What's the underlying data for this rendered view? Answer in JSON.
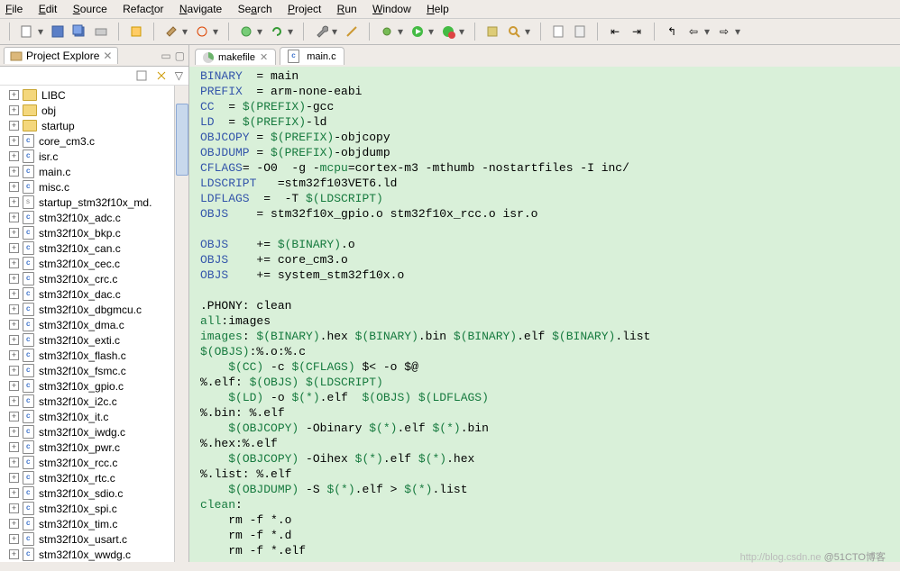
{
  "menubar": {
    "file": "File",
    "edit": "Edit",
    "source": "Source",
    "refactor": "Refactor",
    "navigate": "Navigate",
    "search": "Search",
    "project": "Project",
    "run": "Run",
    "window": "Window",
    "help": "Help"
  },
  "explorer": {
    "title": "Project Explore",
    "items": [
      {
        "name": "LIBC",
        "type": "folder"
      },
      {
        "name": "obj",
        "type": "folder"
      },
      {
        "name": "startup",
        "type": "folder"
      },
      {
        "name": "core_cm3.c",
        "type": "c"
      },
      {
        "name": "isr.c",
        "type": "c"
      },
      {
        "name": "main.c",
        "type": "c"
      },
      {
        "name": "misc.c",
        "type": "c"
      },
      {
        "name": "startup_stm32f10x_md.",
        "type": "s"
      },
      {
        "name": "stm32f10x_adc.c",
        "type": "c"
      },
      {
        "name": "stm32f10x_bkp.c",
        "type": "c"
      },
      {
        "name": "stm32f10x_can.c",
        "type": "c"
      },
      {
        "name": "stm32f10x_cec.c",
        "type": "c"
      },
      {
        "name": "stm32f10x_crc.c",
        "type": "c"
      },
      {
        "name": "stm32f10x_dac.c",
        "type": "c"
      },
      {
        "name": "stm32f10x_dbgmcu.c",
        "type": "c"
      },
      {
        "name": "stm32f10x_dma.c",
        "type": "c"
      },
      {
        "name": "stm32f10x_exti.c",
        "type": "c"
      },
      {
        "name": "stm32f10x_flash.c",
        "type": "c"
      },
      {
        "name": "stm32f10x_fsmc.c",
        "type": "c"
      },
      {
        "name": "stm32f10x_gpio.c",
        "type": "c"
      },
      {
        "name": "stm32f10x_i2c.c",
        "type": "c"
      },
      {
        "name": "stm32f10x_it.c",
        "type": "c"
      },
      {
        "name": "stm32f10x_iwdg.c",
        "type": "c"
      },
      {
        "name": "stm32f10x_pwr.c",
        "type": "c"
      },
      {
        "name": "stm32f10x_rcc.c",
        "type": "c"
      },
      {
        "name": "stm32f10x_rtc.c",
        "type": "c"
      },
      {
        "name": "stm32f10x_sdio.c",
        "type": "c"
      },
      {
        "name": "stm32f10x_spi.c",
        "type": "c"
      },
      {
        "name": "stm32f10x_tim.c",
        "type": "c"
      },
      {
        "name": "stm32f10x_usart.c",
        "type": "c"
      },
      {
        "name": "stm32f10x_wwdg.c",
        "type": "c"
      }
    ]
  },
  "editor": {
    "tabs": [
      {
        "name": "makefile",
        "active": true
      },
      {
        "name": "main.c",
        "active": false
      }
    ]
  },
  "code_lines": [
    {
      "t": "kv",
      "k": "BINARY",
      "op": "=",
      "v": "main"
    },
    {
      "t": "kv",
      "k": "PREFIX",
      "op": "=",
      "v": "arm-none-eabi"
    },
    {
      "t": "kvx",
      "k": "CC",
      "op": "=",
      "x": "$(PREFIX)",
      "s": "-gcc"
    },
    {
      "t": "kvx",
      "k": "LD",
      "op": "=",
      "x": "$(PREFIX)",
      "s": "-ld"
    },
    {
      "t": "kvx",
      "k": "OBJCOPY",
      "op": "=",
      "x": "$(PREFIX)",
      "s": "-objcopy"
    },
    {
      "t": "kvx",
      "k": "OBJDUMP",
      "op": "=",
      "x": "$(PREFIX)",
      "s": "-objdump"
    },
    {
      "t": "raw",
      "html": "<span class='kw'>CFLAGS</span>= -O0  -g -<span class='id'>mcpu</span>=cortex-m3 -mthumb -nostartfiles -I inc/"
    },
    {
      "t": "raw",
      "html": "<span class='kw'>LDSCRIPT</span>   =stm32f103VET6.ld"
    },
    {
      "t": "raw",
      "html": "<span class='kw'>LDFLAGS</span>  =  -T <span class='id'>$(LDSCRIPT)</span>"
    },
    {
      "t": "raw",
      "html": "<span class='kw'>OBJS</span>    = stm32f10x_gpio.o stm32f10x_rcc.o isr.o"
    },
    {
      "t": "blank"
    },
    {
      "t": "raw",
      "html": "<span class='kw'>OBJS</span>    += <span class='id'>$(BINARY)</span>.o"
    },
    {
      "t": "raw",
      "html": "<span class='kw'>OBJS</span>    += core_cm3.o"
    },
    {
      "t": "raw",
      "html": "<span class='kw'>OBJS</span>    += system_stm32f10x.o"
    },
    {
      "t": "blank"
    },
    {
      "t": "raw",
      "html": ".PHONY: clean"
    },
    {
      "t": "raw",
      "html": "<span class='id'>all</span>:images"
    },
    {
      "t": "raw",
      "html": "<span class='id'>images</span>: <span class='id'>$(BINARY)</span>.hex <span class='id'>$(BINARY)</span>.bin <span class='id'>$(BINARY)</span>.elf <span class='id'>$(BINARY)</span>.list"
    },
    {
      "t": "raw",
      "html": "<span class='id'>$(OBJS)</span>:%.o:%.c"
    },
    {
      "t": "raw",
      "html": "    <span class='id'>$(CC)</span> -c <span class='id'>$(CFLAGS)</span> $&lt; -o $@"
    },
    {
      "t": "raw",
      "html": "%.elf: <span class='id'>$(OBJS) $(LDSCRIPT)</span>"
    },
    {
      "t": "raw",
      "html": "    <span class='id'>$(LD)</span> -o <span class='id'>$(*)</span>.elf  <span class='id'>$(OBJS) $(LDFLAGS)</span>"
    },
    {
      "t": "raw",
      "html": "%.bin: %.elf"
    },
    {
      "t": "raw",
      "html": "    <span class='id'>$(OBJCOPY)</span> -Obinary <span class='id'>$(*)</span>.elf <span class='id'>$(*)</span>.bin"
    },
    {
      "t": "raw",
      "html": "%.hex:%.elf"
    },
    {
      "t": "raw",
      "html": "    <span class='id'>$(OBJCOPY)</span> -Oihex <span class='id'>$(*)</span>.elf <span class='id'>$(*)</span>.hex"
    },
    {
      "t": "raw",
      "html": "%.list: %.elf"
    },
    {
      "t": "raw",
      "html": "    <span class='id'>$(OBJDUMP)</span> -S <span class='id'>$(*)</span>.elf &gt; <span class='id'>$(*)</span>.list"
    },
    {
      "t": "raw",
      "html": "<span class='id'>clean</span>:"
    },
    {
      "t": "raw",
      "html": "    rm -f *.o"
    },
    {
      "t": "raw",
      "html": "    rm -f *.d"
    },
    {
      "t": "raw",
      "html": "    rm -f *.elf"
    }
  ],
  "watermark": {
    "url": "http://blog.csdn.ne",
    "cn": "@51CTO博客"
  }
}
